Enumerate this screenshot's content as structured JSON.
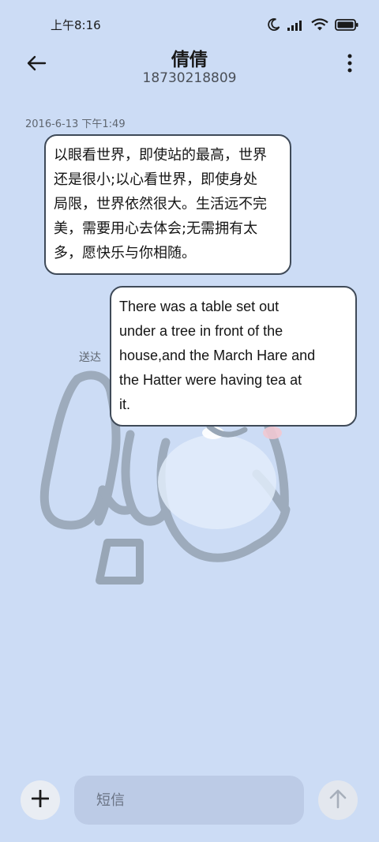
{
  "status_bar": {
    "time": "上午8:16",
    "icons": [
      "moon-icon",
      "signal-icon",
      "wifi-icon",
      "battery-icon"
    ]
  },
  "header": {
    "contact_name": "倩倩",
    "contact_number": "18730218809",
    "back_icon": "back-arrow-icon",
    "more_icon": "more-vertical-icon"
  },
  "conversation": {
    "timestamp": "2016-6-13 下午1:49",
    "messages": [
      {
        "direction": "incoming",
        "text": "以眼看世界，即使站的最高，世界\n还是很小;以心看世界，即使身处\n局限，世界依然很大。生活远不完\n美，需要用心去体会;无需拥有太\n多，愿快乐与你相随。"
      },
      {
        "direction": "outgoing",
        "text": "There was a table set out\nunder a tree in front of the\nhouse,and the March Hare and\nthe Hatter were having tea at\nit.",
        "status": "送达"
      }
    ]
  },
  "compose": {
    "placeholder": "短信",
    "value": "",
    "add_icon": "plus-icon",
    "send_icon": "send-arrow-icon"
  },
  "colors": {
    "background": "#ccdcf5",
    "bubble_border": "#3f4a58",
    "input_background": "#bccbe6"
  }
}
